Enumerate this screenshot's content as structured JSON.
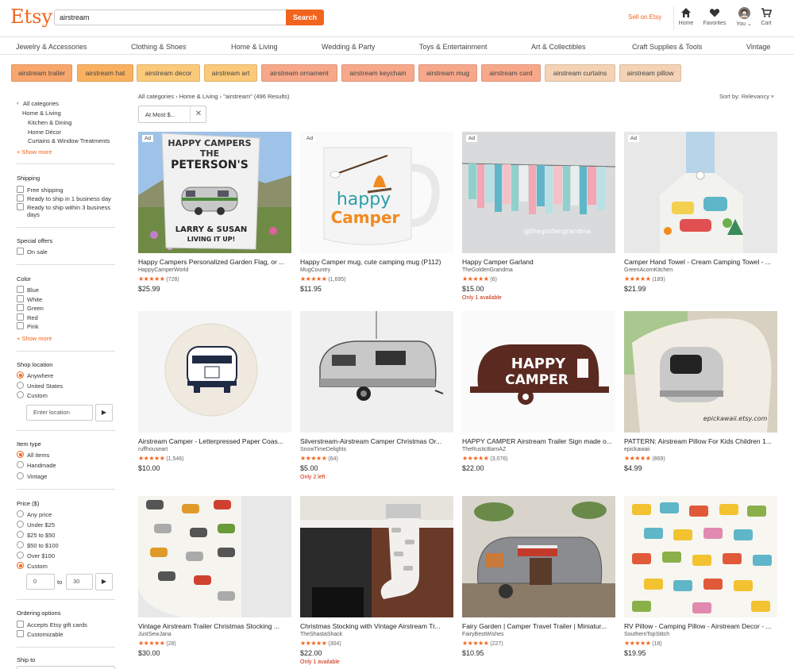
{
  "header": {
    "logo": "Etsy",
    "search_value": "airstream",
    "search_button": "Search",
    "sell_link": "Sell on Etsy",
    "icons": [
      {
        "name": "home-icon",
        "label": "Home"
      },
      {
        "name": "heart-icon",
        "label": "Favorites"
      },
      {
        "name": "avatar",
        "label": "You ⌄"
      },
      {
        "name": "cart-icon",
        "label": "Cart"
      }
    ]
  },
  "nav": [
    "Jewelry & Accessories",
    "Clothing & Shoes",
    "Home & Living",
    "Wedding & Party",
    "Toys & Entertainment",
    "Art & Collectibles",
    "Craft Supplies & Tools",
    "Vintage"
  ],
  "chips": [
    {
      "label": "airstream trailer",
      "color": "#f9a66c"
    },
    {
      "label": "airstream hat",
      "color": "#f9b15f"
    },
    {
      "label": "airstream decor",
      "color": "#fbc97a"
    },
    {
      "label": "airstream art",
      "color": "#fbc97a"
    },
    {
      "label": "airstream ornament",
      "color": "#f7a88a"
    },
    {
      "label": "airstream keychain",
      "color": "#f7a88a"
    },
    {
      "label": "airstream mug",
      "color": "#f7a88a"
    },
    {
      "label": "airstream card",
      "color": "#f7a88a"
    },
    {
      "label": "airstream curtains",
      "color": "#f3d2b5"
    },
    {
      "label": "airstream pillow",
      "color": "#f3d2b5"
    }
  ],
  "sidebar": {
    "all_categories": "All categories",
    "category": "Home & Living",
    "subcategories": [
      "Kitchen & Dining",
      "Home Décor",
      "Curtains & Window Treatments"
    ],
    "show_more": "+ Show more",
    "shipping_title": "Shipping",
    "shipping": [
      "Free shipping",
      "Ready to ship in 1 business day",
      "Ready to ship within 3 business",
      "days"
    ],
    "special_title": "Special offers",
    "special": [
      "On sale"
    ],
    "color_title": "Color",
    "colors": [
      "Blue",
      "White",
      "Green",
      "Red",
      "Pink"
    ],
    "color_show_more": "+ Show more",
    "location_title": "Shop location",
    "locations": [
      "Anywhere",
      "United States",
      "Custom"
    ],
    "location_placeholder": "Enter location",
    "item_type_title": "Item type",
    "item_types": [
      "All items",
      "Handmade",
      "Vintage"
    ],
    "price_title": "Price ($)",
    "prices": [
      "Any price",
      "Under $25",
      "$25 to $50",
      "$50 to $100",
      "Over $100",
      "Custom"
    ],
    "price_min": "0",
    "price_to": "to",
    "price_max": "30",
    "ordering_title": "Ordering options",
    "ordering": [
      "Accepts Etsy gift cards",
      "Customizable"
    ],
    "ship_to_title": "Ship to"
  },
  "main": {
    "crumb_all": "All categories",
    "crumb_cat": "Home & Living",
    "crumb_query": "\"airstream\"",
    "crumb_count": "(496 Results)",
    "sort": "Sort by: Relevancy",
    "filter_chip": "At Most $...",
    "products": [
      {
        "title": "Happy Campers Personalized Garden Flag, or ...",
        "shop": "HappyCamperWorld",
        "reviews": "(728)",
        "price": "$25.99",
        "note": "",
        "ad": "Ad"
      },
      {
        "title": "Happy Camper mug, cute camping mug (P112)",
        "shop": "MugCountry",
        "reviews": "(1,695)",
        "price": "$11.95",
        "note": "",
        "ad": "Ad"
      },
      {
        "title": "Happy Camper Garland",
        "shop": "TheGoldenGrandma",
        "reviews": "(6)",
        "price": "$15.00",
        "note": "Only 1 available",
        "ad": "Ad"
      },
      {
        "title": "Camper Hand Towel - Cream Camping Towel - ...",
        "shop": "GreenAcornKitchen",
        "reviews": "(189)",
        "price": "$21.99",
        "note": "",
        "ad": "Ad"
      },
      {
        "title": "Airstream Camper - Letterpressed Paper Coas...",
        "shop": "ruffhouseart",
        "reviews": "(1,546)",
        "price": "$10.00",
        "note": "",
        "ad": ""
      },
      {
        "title": "Silverstream-Airstream Camper Christmas Or...",
        "shop": "SnowTimeDelights",
        "reviews": "(64)",
        "price": "$5.00",
        "note": "Only 2 left",
        "ad": ""
      },
      {
        "title": "HAPPY CAMPER Airstream Trailer Sign made o...",
        "shop": "TheRusticBarnAZ",
        "reviews": "(3,076)",
        "price": "$22.00",
        "note": "",
        "ad": ""
      },
      {
        "title": "PATTERN: Airstream Pillow For Kids Children 1...",
        "shop": "epickawaii",
        "reviews": "(869)",
        "price": "$4.99",
        "note": "",
        "ad": ""
      },
      {
        "title": "Vintage Airstream Trailer Christmas Stocking ...",
        "shop": "JustSewJana",
        "reviews": "(28)",
        "price": "$30.00",
        "note": "",
        "ad": ""
      },
      {
        "title": "Christmas Stocking with Vintage Airstream Tr...",
        "shop": "TheShastaShack",
        "reviews": "(304)",
        "price": "$22.00",
        "note": "Only 1 available",
        "ad": ""
      },
      {
        "title": "Fairy Garden | Camper Travel Trailer | Miniatur...",
        "shop": "FairyBestWishes",
        "reviews": "(227)",
        "price": "$10.95",
        "note": "",
        "ad": ""
      },
      {
        "title": "RV Pillow - Camping Pillow - Airstream Decor - ...",
        "shop": "SouthernTopStitch",
        "reviews": "(18)",
        "price": "$19.95",
        "note": "",
        "ad": ""
      }
    ],
    "image_text": {
      "flag_line1": "HAPPY CAMPERS",
      "flag_line2": "THE",
      "flag_line3": "PETERSON'S",
      "flag_line4": "LARRY & SUSAN",
      "flag_line5": "LIVING IT UP!",
      "mug_line1": "happy",
      "mug_line2": "Camper",
      "garland_watermark": "@thegoldengrandma",
      "sign_line1": "HAPPY",
      "sign_line2": "CAMPER",
      "pillow_watermark": "epickawaii.etsy.com"
    }
  },
  "stars": "★★★★★"
}
